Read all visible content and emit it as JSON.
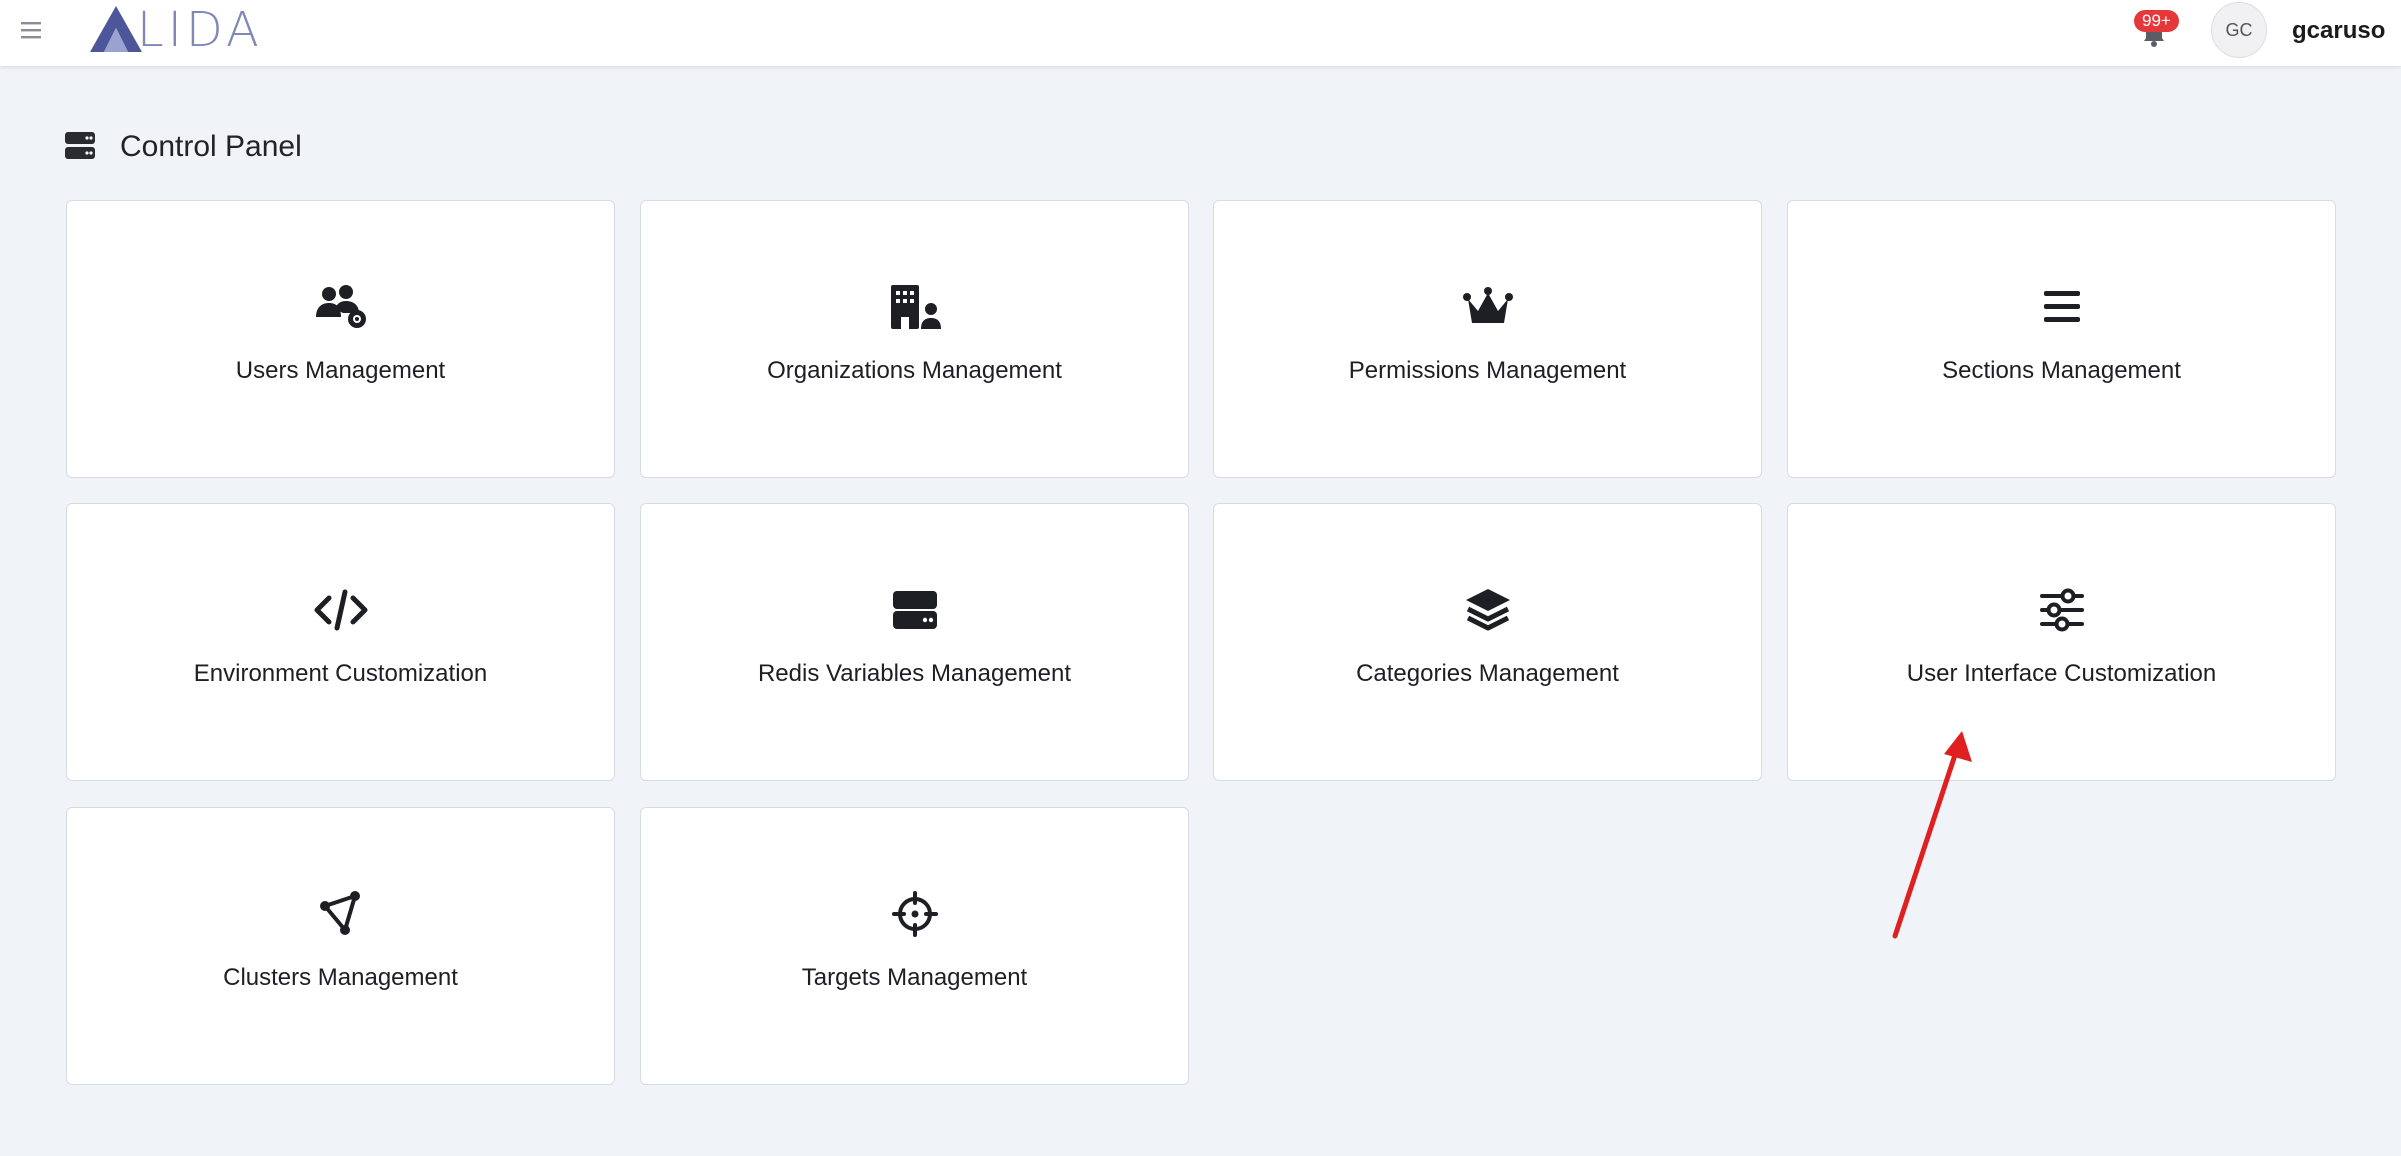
{
  "header": {
    "logo_text": "LIDA",
    "notification_badge": "99+",
    "avatar_initials": "GC",
    "username": "gcaruso"
  },
  "page": {
    "title": "Control Panel",
    "cards": [
      {
        "label": "Users Management",
        "icon": "users-gear-icon"
      },
      {
        "label": "Organizations Management",
        "icon": "building-user-icon"
      },
      {
        "label": "Permissions Management",
        "icon": "crown-icon"
      },
      {
        "label": "Sections Management",
        "icon": "bars-icon"
      },
      {
        "label": "Environment Customization",
        "icon": "code-icon"
      },
      {
        "label": "Redis Variables Management",
        "icon": "server-icon"
      },
      {
        "label": "Categories Management",
        "icon": "layers-icon"
      },
      {
        "label": "User Interface Customization",
        "icon": "sliders-icon"
      },
      {
        "label": "Clusters Management",
        "icon": "cluster-nodes-icon"
      },
      {
        "label": "Targets Management",
        "icon": "crosshair-icon"
      }
    ]
  },
  "colors": {
    "background": "#f0f3f8",
    "badge": "#e5383b",
    "annotation_arrow": "#e02020",
    "logo": "#8088b5"
  }
}
